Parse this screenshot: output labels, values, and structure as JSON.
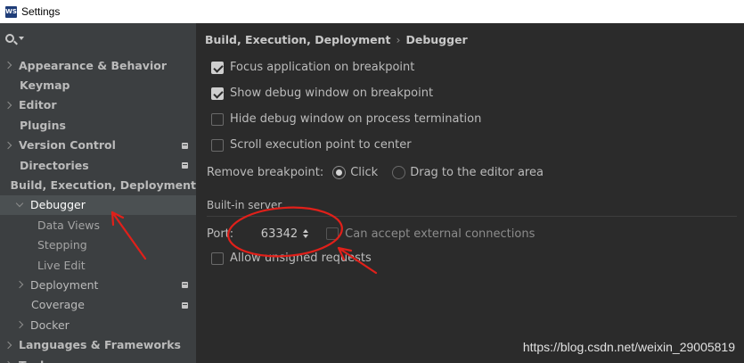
{
  "window": {
    "title": "Settings",
    "app_icon": "WS"
  },
  "search": {
    "icon": "search-icon"
  },
  "sidebar": {
    "items": [
      {
        "label": "Appearance & Behavior",
        "indent": 0,
        "chevron": "right",
        "bold": true,
        "badge": false,
        "selected": false
      },
      {
        "label": "Keymap",
        "indent": 0,
        "chevron": "none",
        "bold": true,
        "badge": false,
        "selected": false
      },
      {
        "label": "Editor",
        "indent": 0,
        "chevron": "right",
        "bold": true,
        "badge": false,
        "selected": false
      },
      {
        "label": "Plugins",
        "indent": 0,
        "chevron": "none",
        "bold": true,
        "badge": false,
        "selected": false
      },
      {
        "label": "Version Control",
        "indent": 0,
        "chevron": "right",
        "bold": true,
        "badge": true,
        "selected": false
      },
      {
        "label": "Directories",
        "indent": 0,
        "chevron": "none",
        "bold": true,
        "badge": true,
        "selected": false
      },
      {
        "label": "Build, Execution, Deployment",
        "indent": 0,
        "chevron": "none",
        "bold": true,
        "badge": false,
        "selected": false
      },
      {
        "label": "Debugger",
        "indent": 1,
        "chevron": "down",
        "bold": false,
        "badge": false,
        "selected": true
      },
      {
        "label": "Data Views",
        "indent": 2,
        "chevron": "none",
        "bold": false,
        "badge": false,
        "selected": false
      },
      {
        "label": "Stepping",
        "indent": 2,
        "chevron": "none",
        "bold": false,
        "badge": false,
        "selected": false
      },
      {
        "label": "Live Edit",
        "indent": 2,
        "chevron": "none",
        "bold": false,
        "badge": false,
        "selected": false
      },
      {
        "label": "Deployment",
        "indent": 1,
        "chevron": "right",
        "bold": false,
        "badge": true,
        "selected": false
      },
      {
        "label": "Coverage",
        "indent": 1,
        "chevron": "none",
        "bold": false,
        "badge": true,
        "selected": false
      },
      {
        "label": "Docker",
        "indent": 1,
        "chevron": "right",
        "bold": false,
        "badge": false,
        "selected": false
      },
      {
        "label": "Languages & Frameworks",
        "indent": 0,
        "chevron": "right",
        "bold": true,
        "badge": false,
        "selected": false
      },
      {
        "label": "Tools",
        "indent": 0,
        "chevron": "right",
        "bold": true,
        "badge": false,
        "selected": false
      }
    ]
  },
  "breadcrumb": {
    "parent": "Build, Execution, Deployment",
    "separator": "›",
    "current": "Debugger"
  },
  "options": {
    "focus_app": {
      "label": "Focus application on breakpoint",
      "checked": true
    },
    "show_debug": {
      "label": "Show debug window on breakpoint",
      "checked": true
    },
    "hide_debug": {
      "label": "Hide debug window on process termination",
      "checked": false
    },
    "scroll_exec": {
      "label": "Scroll execution point to center",
      "checked": false
    }
  },
  "remove_breakpoint": {
    "label": "Remove breakpoint:",
    "options": [
      {
        "label": "Click",
        "selected": true
      },
      {
        "label": "Drag to the editor area",
        "selected": false
      }
    ]
  },
  "builtin_server": {
    "title": "Built-in server",
    "port_label": "Port:",
    "port_value": "63342",
    "external_label": "Can accept external connections",
    "external_checked": false,
    "unsigned_label": "Allow unsigned requests",
    "unsigned_checked": false
  },
  "watermark": "https://blog.csdn.net/weixin_29005819",
  "colors": {
    "annotation": "#e0201a",
    "selection": "#4b5052",
    "sidebar_bg": "#3c3f41",
    "main_bg": "#2b2b2b"
  }
}
